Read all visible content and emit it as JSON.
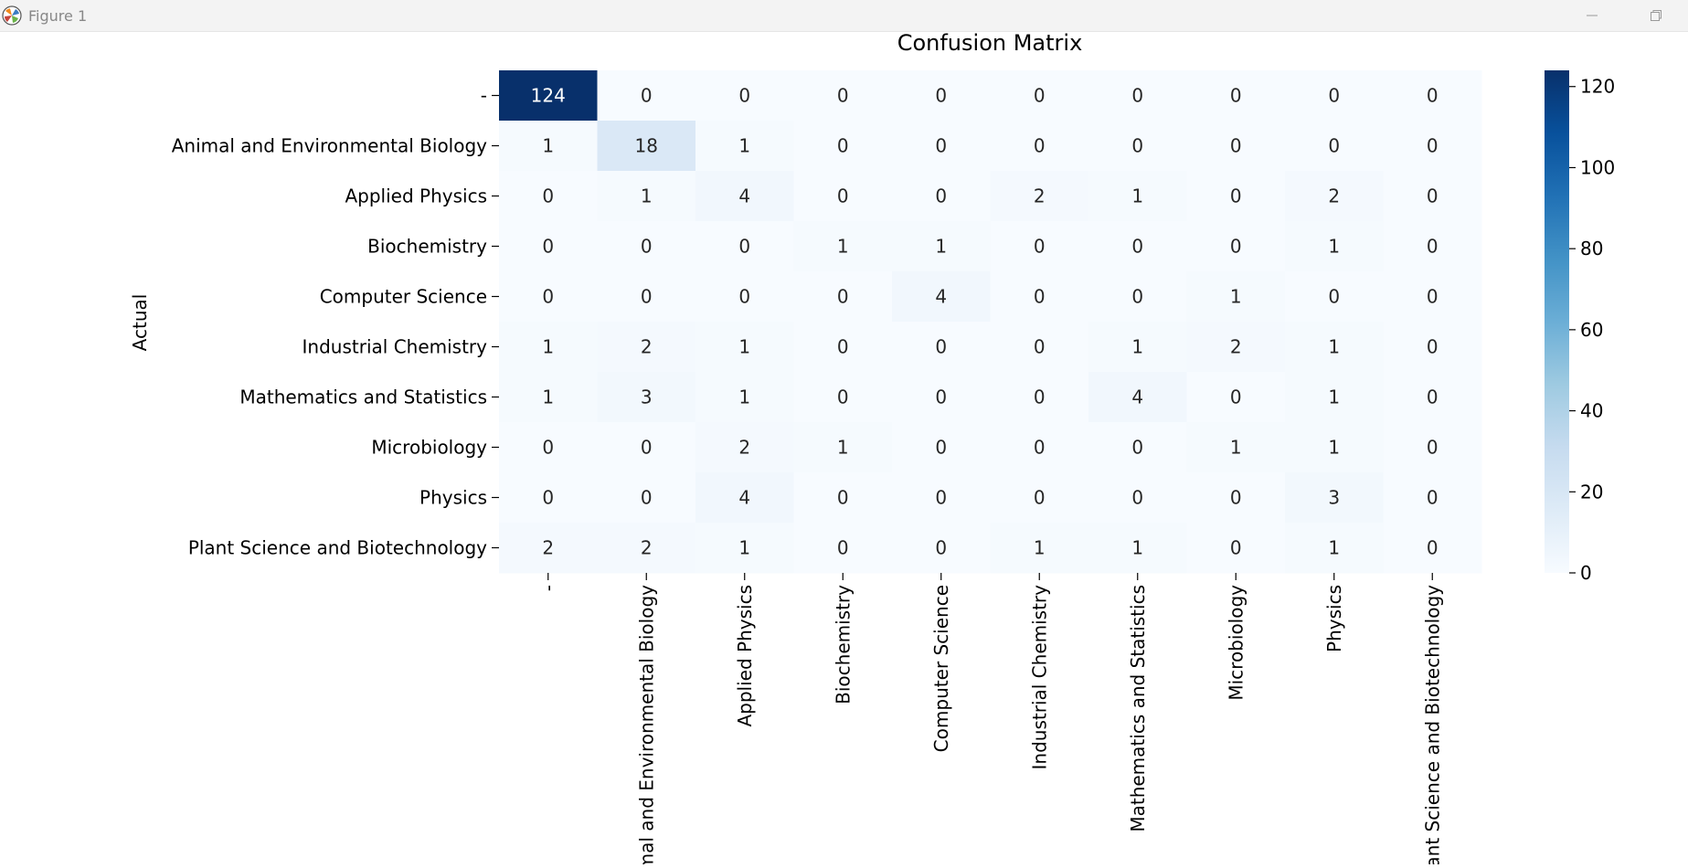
{
  "window": {
    "title": "Figure 1",
    "app_icon": "matplotlib-icon",
    "minimize_icon": "minimize-icon",
    "maximize_icon": "restore-icon"
  },
  "chart_data": {
    "type": "heatmap",
    "title": "Confusion Matrix",
    "xlabel": "",
    "ylabel": "Actual",
    "row_labels": [
      "-",
      "Animal and Environmental Biology",
      "Applied Physics",
      "Biochemistry",
      "Computer Science",
      "Industrial Chemistry",
      "Mathematics and Statistics",
      "Microbiology",
      "Physics",
      "Plant Science and Biotechnology"
    ],
    "col_labels": [
      "-",
      "Animal and Environmental Biology",
      "Applied Physics",
      "Biochemistry",
      "Computer Science",
      "Industrial Chemistry",
      "Mathematics and Statistics",
      "Microbiology",
      "Physics",
      "Plant Science and Biotechnology"
    ],
    "values": [
      [
        124,
        0,
        0,
        0,
        0,
        0,
        0,
        0,
        0,
        0
      ],
      [
        1,
        18,
        1,
        0,
        0,
        0,
        0,
        0,
        0,
        0
      ],
      [
        0,
        1,
        4,
        0,
        0,
        2,
        1,
        0,
        2,
        0
      ],
      [
        0,
        0,
        0,
        1,
        1,
        0,
        0,
        0,
        1,
        0
      ],
      [
        0,
        0,
        0,
        0,
        4,
        0,
        0,
        1,
        0,
        0
      ],
      [
        1,
        2,
        1,
        0,
        0,
        0,
        1,
        2,
        1,
        0
      ],
      [
        1,
        3,
        1,
        0,
        0,
        0,
        4,
        0,
        1,
        0
      ],
      [
        0,
        0,
        2,
        1,
        0,
        0,
        0,
        1,
        1,
        0
      ],
      [
        0,
        0,
        4,
        0,
        0,
        0,
        0,
        0,
        3,
        0
      ],
      [
        2,
        2,
        1,
        0,
        0,
        1,
        1,
        0,
        1,
        0
      ]
    ],
    "colormap": "Blues",
    "colorbar": {
      "min": 0,
      "max": 124,
      "ticks": [
        0,
        20,
        40,
        60,
        80,
        100,
        120
      ]
    },
    "annotated": true
  }
}
